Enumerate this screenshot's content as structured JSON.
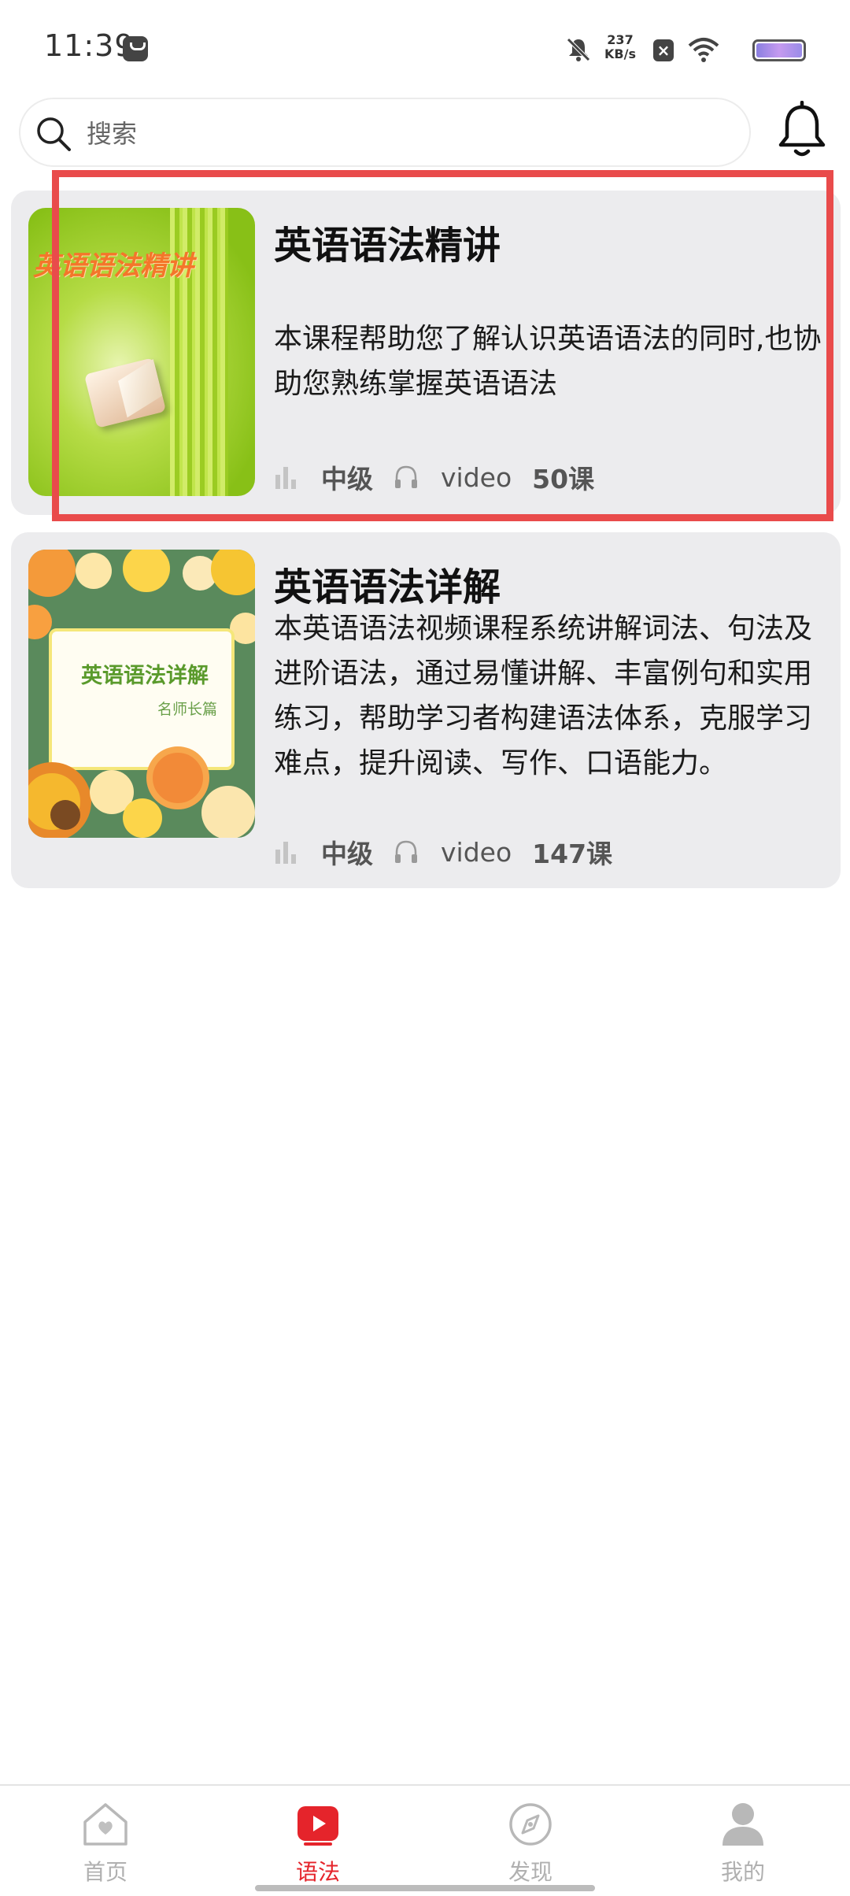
{
  "status_bar": {
    "time": "11:39",
    "net_speed_value": "237",
    "net_speed_unit": "KB/s"
  },
  "search": {
    "placeholder": "搜索"
  },
  "courses": [
    {
      "title": "英语语法精讲",
      "thumb_title": "英语语法精讲",
      "description": "本课程帮助您了解认识英语语法的同时,也协助您熟练掌握英语语法",
      "level": "中级",
      "media": "video",
      "lessons": "50课"
    },
    {
      "title": "英语语法详解",
      "thumb_title": "英语语法详解",
      "thumb_subtitle": "名师长篇",
      "description": "本英语语法视频课程系统讲解词法、句法及进阶语法，通过易懂讲解、丰富例句和实用练习，帮助学习者构建语法体系，克服学习难点，提升阅读、写作、口语能力。",
      "level": "中级",
      "media": "video",
      "lessons": "147课"
    }
  ],
  "bottom_nav": [
    {
      "label": "首页",
      "icon": "home-heart-icon",
      "active": false
    },
    {
      "label": "语法",
      "icon": "play-icon",
      "active": true
    },
    {
      "label": "发现",
      "icon": "compass-icon",
      "active": false
    },
    {
      "label": "我的",
      "icon": "person-icon",
      "active": false
    }
  ],
  "colors": {
    "accent": "#e5242b",
    "highlight": "#e94b4b",
    "card_bg": "#ececee",
    "nav_inactive": "#b0b0b0"
  }
}
